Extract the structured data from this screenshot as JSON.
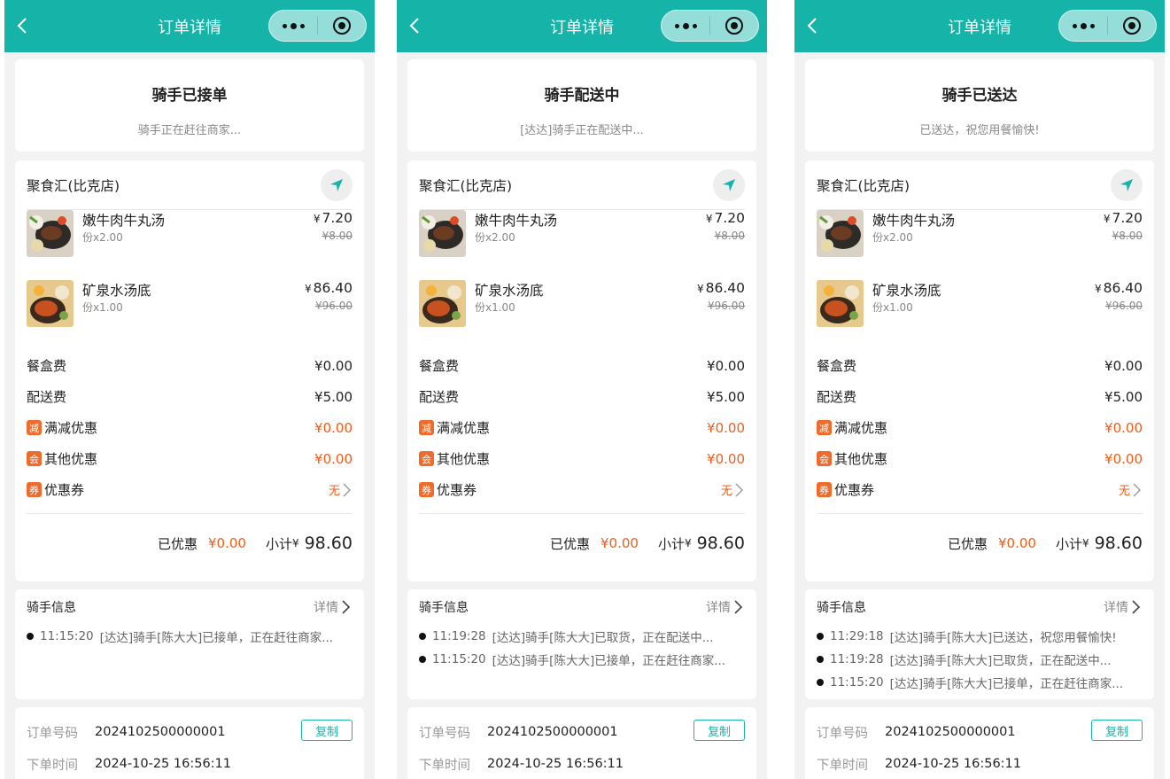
{
  "colors": {
    "brand": "#16b3a9",
    "accent": "#f25c19",
    "badge": "#ef6b2b"
  },
  "screens": [
    {
      "nav": {
        "title": "订单详情"
      },
      "status": {
        "title": "骑手已接单",
        "subtitle": "骑手正在赶往商家..."
      },
      "shop": {
        "name": "聚食汇(比克店)"
      },
      "items": [
        {
          "name": "嫩牛肉牛丸汤",
          "qty": "份x2.00",
          "yen": "¥",
          "price": "7.20",
          "orig": "¥8.00"
        },
        {
          "name": "矿泉水汤底",
          "qty": "份x1.00",
          "yen": "¥",
          "price": "86.40",
          "orig": "¥96.00"
        }
      ],
      "fees": {
        "box": {
          "label": "餐盒费",
          "value": "¥0.00"
        },
        "delivery": {
          "label": "配送费",
          "value": "¥5.00"
        },
        "full_reduce": {
          "badge": "减",
          "label": "满减优惠",
          "value": "¥0.00"
        },
        "other": {
          "badge": "会",
          "label": "其他优惠",
          "value": "¥0.00"
        },
        "coupon": {
          "badge": "券",
          "label": "优惠券",
          "value": "无"
        }
      },
      "summary": {
        "discount_label": "已优惠",
        "discount_value": "¥0.00",
        "subtotal_label": "小计",
        "yen": "¥",
        "subtotal_value": "98.60"
      },
      "rider": {
        "title": "骑手信息",
        "detail": "详情",
        "logs": [
          {
            "time": "11:15:20",
            "text": "[达达]骑手[陈大大]已接单，正在赶往商家..."
          }
        ]
      },
      "info": {
        "order_no_label": "订单号码",
        "order_no": "2024102500000001",
        "copy": "复制",
        "time_label": "下单时间",
        "time": "2024-10-25 16:56:11"
      }
    },
    {
      "nav": {
        "title": "订单详情"
      },
      "status": {
        "title": "骑手配送中",
        "subtitle": "[达达]骑手正在配送中..."
      },
      "shop": {
        "name": "聚食汇(比克店)"
      },
      "items": [
        {
          "name": "嫩牛肉牛丸汤",
          "qty": "份x2.00",
          "yen": "¥",
          "price": "7.20",
          "orig": "¥8.00"
        },
        {
          "name": "矿泉水汤底",
          "qty": "份x1.00",
          "yen": "¥",
          "price": "86.40",
          "orig": "¥96.00"
        }
      ],
      "fees": {
        "box": {
          "label": "餐盒费",
          "value": "¥0.00"
        },
        "delivery": {
          "label": "配送费",
          "value": "¥5.00"
        },
        "full_reduce": {
          "badge": "减",
          "label": "满减优惠",
          "value": "¥0.00"
        },
        "other": {
          "badge": "会",
          "label": "其他优惠",
          "value": "¥0.00"
        },
        "coupon": {
          "badge": "券",
          "label": "优惠券",
          "value": "无"
        }
      },
      "summary": {
        "discount_label": "已优惠",
        "discount_value": "¥0.00",
        "subtotal_label": "小计",
        "yen": "¥",
        "subtotal_value": "98.60"
      },
      "rider": {
        "title": "骑手信息",
        "detail": "详情",
        "logs": [
          {
            "time": "11:19:28",
            "text": "[达达]骑手[陈大大]已取货，正在配送中..."
          },
          {
            "time": "11:15:20",
            "text": "[达达]骑手[陈大大]已接单，正在赶往商家..."
          }
        ]
      },
      "info": {
        "order_no_label": "订单号码",
        "order_no": "2024102500000001",
        "copy": "复制",
        "time_label": "下单时间",
        "time": "2024-10-25 16:56:11"
      }
    },
    {
      "nav": {
        "title": "订单详情"
      },
      "status": {
        "title": "骑手已送达",
        "subtitle": "已送达，祝您用餐愉快!"
      },
      "shop": {
        "name": "聚食汇(比克店)"
      },
      "items": [
        {
          "name": "嫩牛肉牛丸汤",
          "qty": "份x2.00",
          "yen": "¥",
          "price": "7.20",
          "orig": "¥8.00"
        },
        {
          "name": "矿泉水汤底",
          "qty": "份x1.00",
          "yen": "¥",
          "price": "86.40",
          "orig": "¥96.00"
        }
      ],
      "fees": {
        "box": {
          "label": "餐盒费",
          "value": "¥0.00"
        },
        "delivery": {
          "label": "配送费",
          "value": "¥5.00"
        },
        "full_reduce": {
          "badge": "减",
          "label": "满减优惠",
          "value": "¥0.00"
        },
        "other": {
          "badge": "会",
          "label": "其他优惠",
          "value": "¥0.00"
        },
        "coupon": {
          "badge": "券",
          "label": "优惠券",
          "value": "无"
        }
      },
      "summary": {
        "discount_label": "已优惠",
        "discount_value": "¥0.00",
        "subtotal_label": "小计",
        "yen": "¥",
        "subtotal_value": "98.60"
      },
      "rider": {
        "title": "骑手信息",
        "detail": "详情",
        "logs": [
          {
            "time": "11:29:18",
            "text": "[达达]骑手[陈大大]已送达，祝您用餐愉快!"
          },
          {
            "time": "11:19:28",
            "text": "[达达]骑手[陈大大]已取货，正在配送中..."
          },
          {
            "time": "11:15:20",
            "text": "[达达]骑手[陈大大]已接单，正在赶往商家..."
          }
        ]
      },
      "info": {
        "order_no_label": "订单号码",
        "order_no": "2024102500000001",
        "copy": "复制",
        "time_label": "下单时间",
        "time": "2024-10-25 16:56:11"
      }
    }
  ]
}
